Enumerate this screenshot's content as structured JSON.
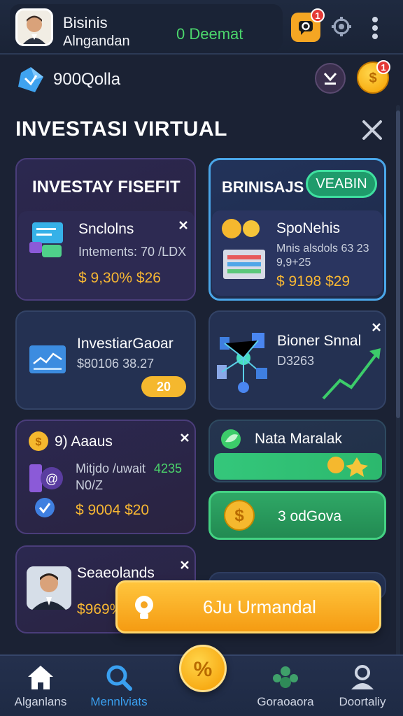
{
  "header": {
    "profile_name": "Bisinis",
    "profile_sub": "Alngandan",
    "status_text": "0 Deemat",
    "notif_count": "1",
    "coin_count": "1"
  },
  "wallet": {
    "balance": "900Qolla"
  },
  "section": {
    "title": "INVESTASI VIRTUAL"
  },
  "cards": {
    "c1": {
      "title": "INVESTAY FISEFIT",
      "item_title": "Snclolns",
      "item_sub": "Intements: 70 /LDX",
      "item_price": "$ 9,30% $26"
    },
    "c2": {
      "title": "BRINISAJS",
      "pill": "VEABIN",
      "item_title": "SpoNehis",
      "item_sub": "Mnis alsdols 63 23",
      "item_sub2": "9,9+25",
      "item_price": "$ 9198 $29"
    },
    "c3": {
      "title": "InvestiarGaoar",
      "sub": "$80106 38.27",
      "badge": "20"
    },
    "c4": {
      "title": "Bioner Snnal",
      "sub": "D3263"
    },
    "c5": {
      "title": "9) Aaaus",
      "sub": "Mitjdo /uwait",
      "sub_green": "4235",
      "sub2": "N0/Z",
      "price": "$ 9004 $20"
    },
    "c6": {
      "title": "Nata Maralak"
    },
    "c7": {
      "label": "3 odGova"
    },
    "c8": {
      "title": "Seaeolands",
      "price": "$969%"
    }
  },
  "cta": {
    "label": "6Ju Urmandal"
  },
  "nav": {
    "items": [
      {
        "label": "Alganlans"
      },
      {
        "label": "Mennlviats"
      },
      {
        "label": "Goraoaora"
      },
      {
        "label": "Doortaliy"
      }
    ],
    "fab_symbol": "%"
  },
  "colors": {
    "accent": "#f5a623",
    "green": "#4bd66c",
    "price": "#f7b733",
    "background": "#1b2234"
  }
}
